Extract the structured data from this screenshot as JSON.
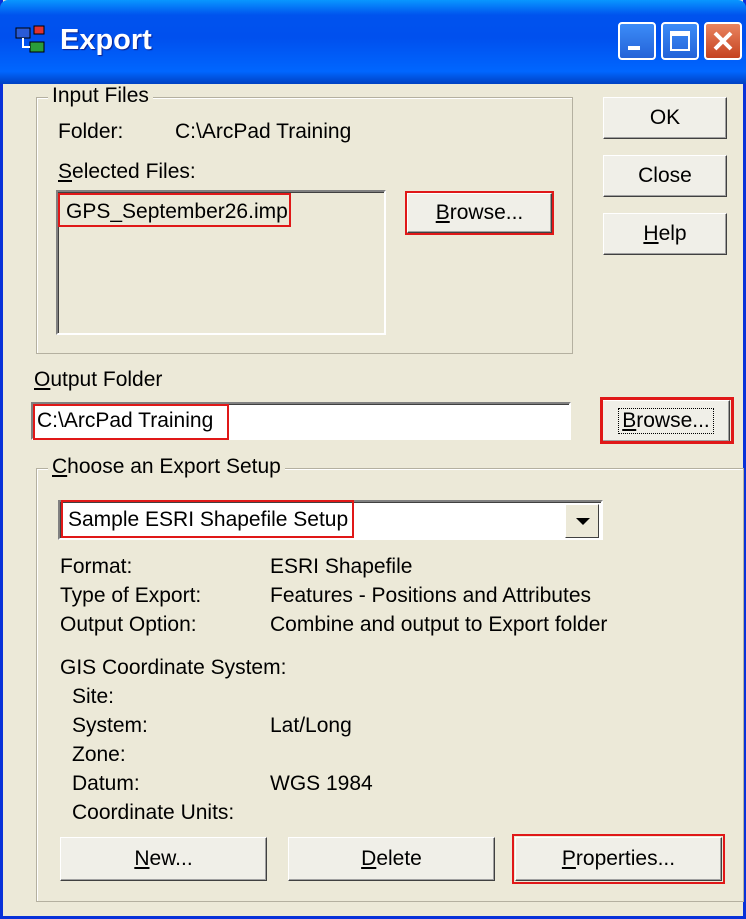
{
  "window": {
    "title": "Export"
  },
  "input_files": {
    "group_label": "Input Files",
    "folder_label": "Folder:",
    "folder_value": "C:\\ArcPad Training",
    "selected_files_label": "Selected Files:",
    "selected_files": [
      "GPS_September26.imp"
    ],
    "browse_label": "Browse..."
  },
  "buttons": {
    "ok": "OK",
    "close": "Close",
    "help": "Help"
  },
  "output_folder": {
    "label": "Output Folder",
    "value": "C:\\ArcPad Training",
    "browse_label": "Browse..."
  },
  "export_setup": {
    "group_label": "Choose an Export Setup",
    "selected": "Sample ESRI Shapefile Setup",
    "details": [
      {
        "label": "Format:",
        "value": "ESRI Shapefile"
      },
      {
        "label": "Type of Export:",
        "value": "Features - Positions and Attributes"
      },
      {
        "label": "Output Option:",
        "value": "Combine and output to Export folder"
      }
    ],
    "gis_label": "GIS Coordinate System:",
    "gis": [
      {
        "label": "Site:",
        "value": ""
      },
      {
        "label": "System:",
        "value": "Lat/Long"
      },
      {
        "label": "Zone:",
        "value": ""
      },
      {
        "label": "Datum:",
        "value": "WGS 1984"
      },
      {
        "label": "Coordinate Units:",
        "value": ""
      }
    ],
    "new_label": "New...",
    "delete_label": "Delete",
    "properties_label": "Properties..."
  },
  "colors": {
    "titlebar": "#0053ee",
    "dialog": "#ece9d8",
    "highlight": "#e01818"
  },
  "icons": [
    "export-app-icon",
    "minimize-icon",
    "maximize-icon",
    "close-icon",
    "dropdown-arrow-icon"
  ]
}
